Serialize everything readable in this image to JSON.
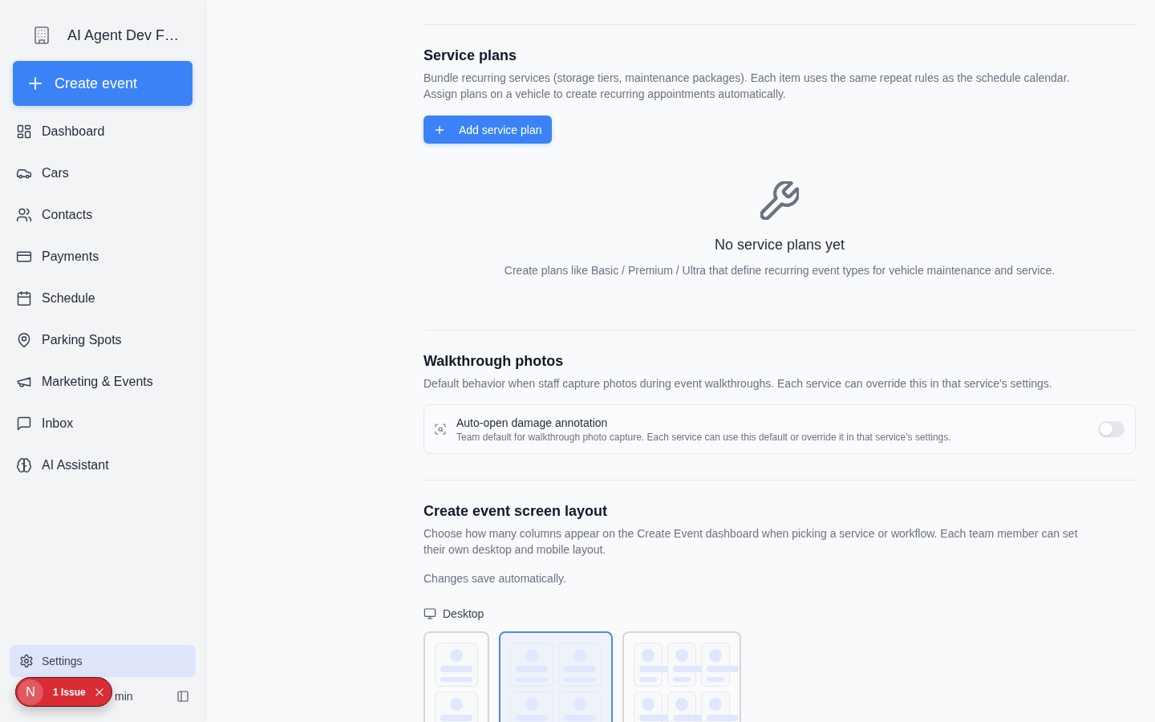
{
  "sidebar": {
    "workspace": {
      "name": "AI Agent Dev F…"
    },
    "create_button": {
      "label": "Create event"
    },
    "nav": [
      {
        "label": "Dashboard",
        "selected": false
      },
      {
        "label": "Cars",
        "selected": false
      },
      {
        "label": "Contacts",
        "selected": false
      },
      {
        "label": "Payments",
        "selected": false
      },
      {
        "label": "Schedule",
        "selected": false
      },
      {
        "label": "Parking Spots",
        "selected": false
      },
      {
        "label": "Marketing & Events",
        "selected": false
      },
      {
        "label": "Inbox",
        "selected": false
      },
      {
        "label": "AI Assistant",
        "selected": false
      }
    ],
    "footer_nav": [
      {
        "label": "Settings",
        "selected": true
      }
    ],
    "user": {
      "name": "min"
    }
  },
  "dev_indicator": {
    "logo": "N",
    "label": "1 Issue"
  },
  "service_plans": {
    "title": "Service plans",
    "description": "Bundle recurring services (storage tiers, maintenance packages). Each item uses the same repeat rules as the schedule calendar.\nAssign plans on a vehicle to create recurring appointments automatically.",
    "add_button": {
      "label": "Add service plan"
    },
    "empty_state": {
      "title": "No service plans yet",
      "description": "Create plans like Basic / Premium / Ultra that define recurring event types for vehicle maintenance and service."
    }
  },
  "walkthrough_photos": {
    "title": "Walkthrough photos",
    "description": "Default behavior when staff capture photos during event walkthroughs. Each service can override this in that service's settings.",
    "settings": [
      {
        "title": "Auto-open damage annotation",
        "description": "Team default for walkthrough photo capture. Each service can use this default or override it in that service's settings.",
        "on": false
      }
    ]
  },
  "create_event_layout": {
    "title": "Create event screen layout",
    "description": "Choose how many columns appear on the Create Event dashboard when picking a service or workflow. Each team member can set\ntheir own desktop and mobile layout.",
    "note": "Changes save automatically.",
    "devices": [
      {
        "label": "Desktop",
        "options": [
          {
            "kind": "single",
            "selected": false
          },
          {
            "kind": "double",
            "selected": true
          },
          {
            "kind": "triple",
            "selected": false
          }
        ]
      }
    ]
  }
}
